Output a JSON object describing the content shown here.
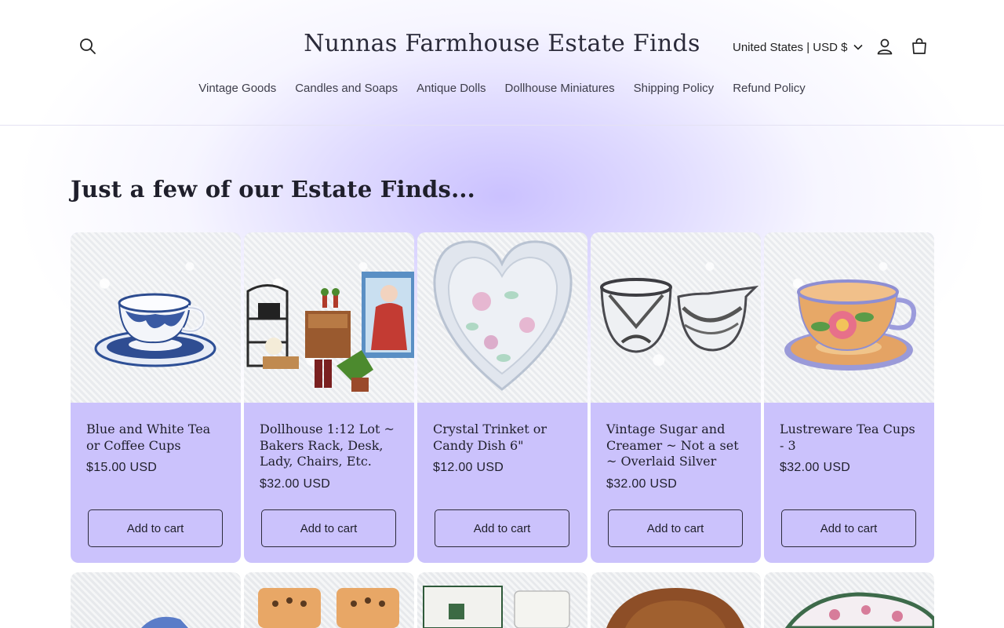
{
  "header": {
    "store_name": "Nunnas Farmhouse Estate Finds",
    "currency_label": "United States | USD $",
    "nav": [
      {
        "label": "Vintage Goods"
      },
      {
        "label": "Candles and Soaps"
      },
      {
        "label": "Antique Dolls"
      },
      {
        "label": "Dollhouse Miniatures"
      },
      {
        "label": "Shipping Policy"
      },
      {
        "label": "Refund Policy"
      }
    ],
    "icons": {
      "search": "search-icon",
      "account": "account-icon",
      "cart": "cart-icon",
      "chevron": "chevron-down-icon"
    }
  },
  "section": {
    "title": "Just a few of our Estate Finds...",
    "products": [
      {
        "title": "Blue and White Tea or Coffee Cups",
        "price": "$15.00 USD",
        "button": "Add to cart"
      },
      {
        "title": "Dollhouse 1:12 Lot ~ Bakers Rack, Desk, Lady, Chairs, Etc.",
        "price": "$32.00 USD",
        "button": "Add to cart"
      },
      {
        "title": "Crystal Trinket or Candy Dish 6\"",
        "price": "$12.00 USD",
        "button": "Add to cart"
      },
      {
        "title": "Vintage Sugar and Creamer ~ Not a set ~ Overlaid Silver",
        "price": "$32.00 USD",
        "button": "Add to cart"
      },
      {
        "title": "Lustreware Tea Cups - 3",
        "price": "$32.00 USD",
        "button": "Add to cart"
      }
    ]
  },
  "colors": {
    "card_background": "#cbc2fc",
    "accent_glow": "#c8beff",
    "text": "#1f1f2b"
  }
}
